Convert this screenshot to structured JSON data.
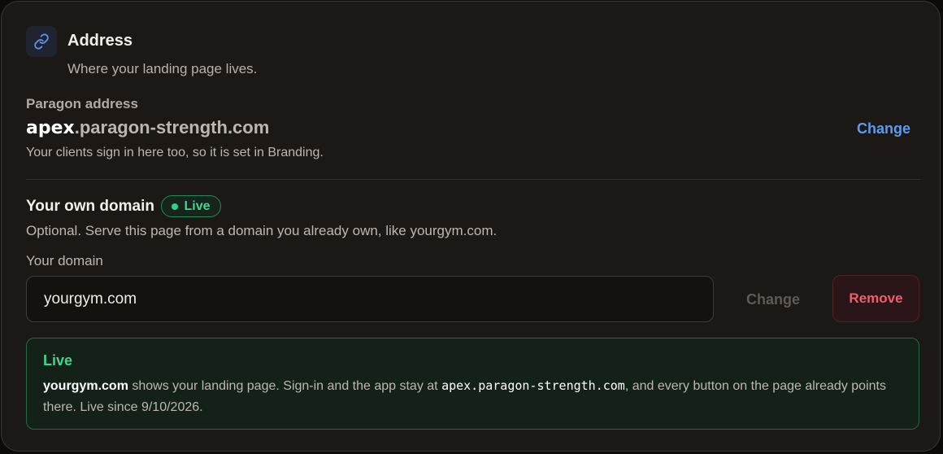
{
  "header": {
    "icon": "link-icon",
    "title": "Address",
    "subtitle": "Where your landing page lives."
  },
  "paragon_address": {
    "label": "Paragon address",
    "subdomain": "apex",
    "domain": ".paragon-strength.com",
    "change_label": "Change",
    "help": "Your clients sign in here too, so it is set in Branding."
  },
  "own_domain": {
    "title": "Your own domain",
    "badge": "Live",
    "help": "Optional. Serve this page from a domain you already own, like yourgym.com.",
    "field_label": "Your domain",
    "value": "yourgym.com",
    "change_label": "Change",
    "remove_label": "Remove"
  },
  "status": {
    "title": "Live",
    "domain": "yourgym.com",
    "text_1": " shows your landing page. Sign-in and the app stay at ",
    "app_host": "apex.paragon-strength.com",
    "text_2": ", and every button on the page already points there. Live since 9/10/2026."
  },
  "colors": {
    "accent_blue": "#5b9cf0",
    "live_green": "#3fd68f",
    "danger_red": "#f25d6e"
  }
}
